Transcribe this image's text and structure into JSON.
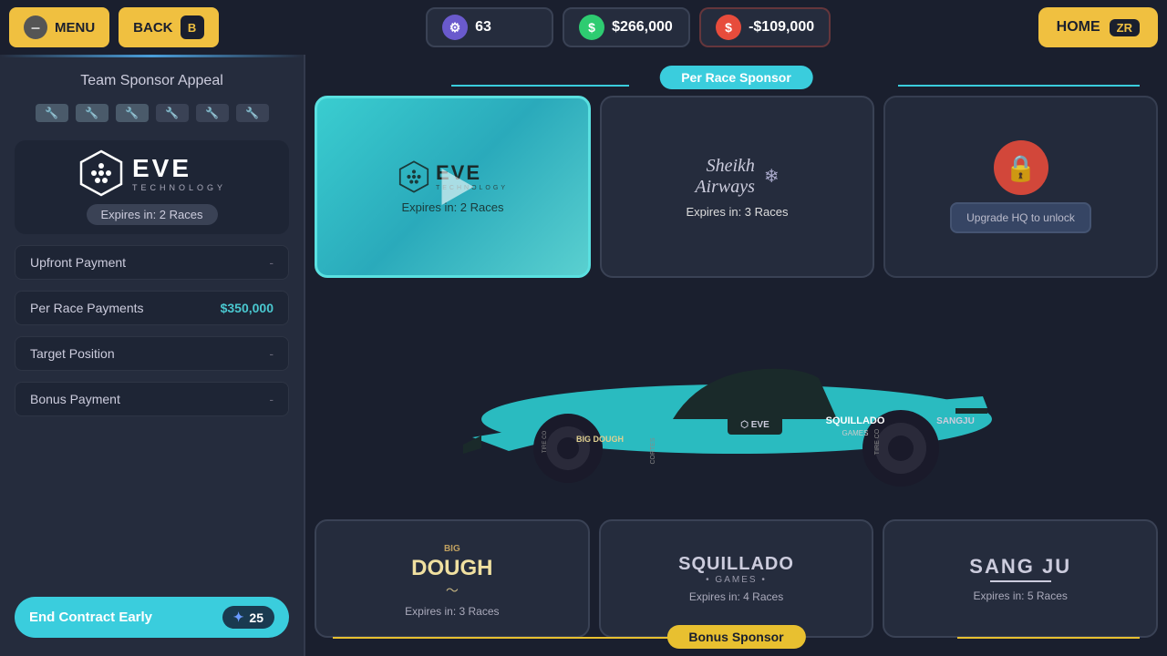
{
  "topbar": {
    "menu_label": "MENU",
    "menu_badge": "●",
    "back_label": "BACK",
    "back_badge": "B",
    "tech_value": "63",
    "money_value": "$266,000",
    "spend_value": "-$109,000",
    "home_label": "HOME",
    "home_badge": "ZR"
  },
  "left": {
    "appeal_title": "Team Sponsor Appeal",
    "sponsor_name": "EVE",
    "sponsor_sub": "TECHNOLOGY",
    "expires_label": "Expires in: 2 Races",
    "contract_items": [
      {
        "label": "Upfront Payment",
        "value": "-"
      },
      {
        "label": "Per Race Payments",
        "value": "$350,000"
      },
      {
        "label": "Target Position",
        "value": "-"
      },
      {
        "label": "Bonus Payment",
        "value": "-"
      }
    ],
    "end_contract_label": "End Contract Early",
    "end_contract_cost": "25"
  },
  "right": {
    "per_race_label": "Per Race Sponsor",
    "bonus_sponsor_label": "Bonus Sponsor",
    "top_sponsors": [
      {
        "name": "EVE Technology",
        "expires": "Expires in: 2 Races",
        "type": "active"
      },
      {
        "name": "Sheikh Airways",
        "expires": "Expires in: 3 Races",
        "type": "inactive"
      },
      {
        "name": "Locked",
        "expires": "Upgrade HQ to unlock",
        "type": "locked"
      }
    ],
    "bottom_sponsors": [
      {
        "name": "Big Dough",
        "expires": "Expires in: 3 Races",
        "type": "big_dough"
      },
      {
        "name": "Squillado Games",
        "expires": "Expires in: 4 Races",
        "type": "squillado"
      },
      {
        "name": "Sangju",
        "expires": "Expires in: 5 Races",
        "type": "sangju"
      }
    ]
  }
}
